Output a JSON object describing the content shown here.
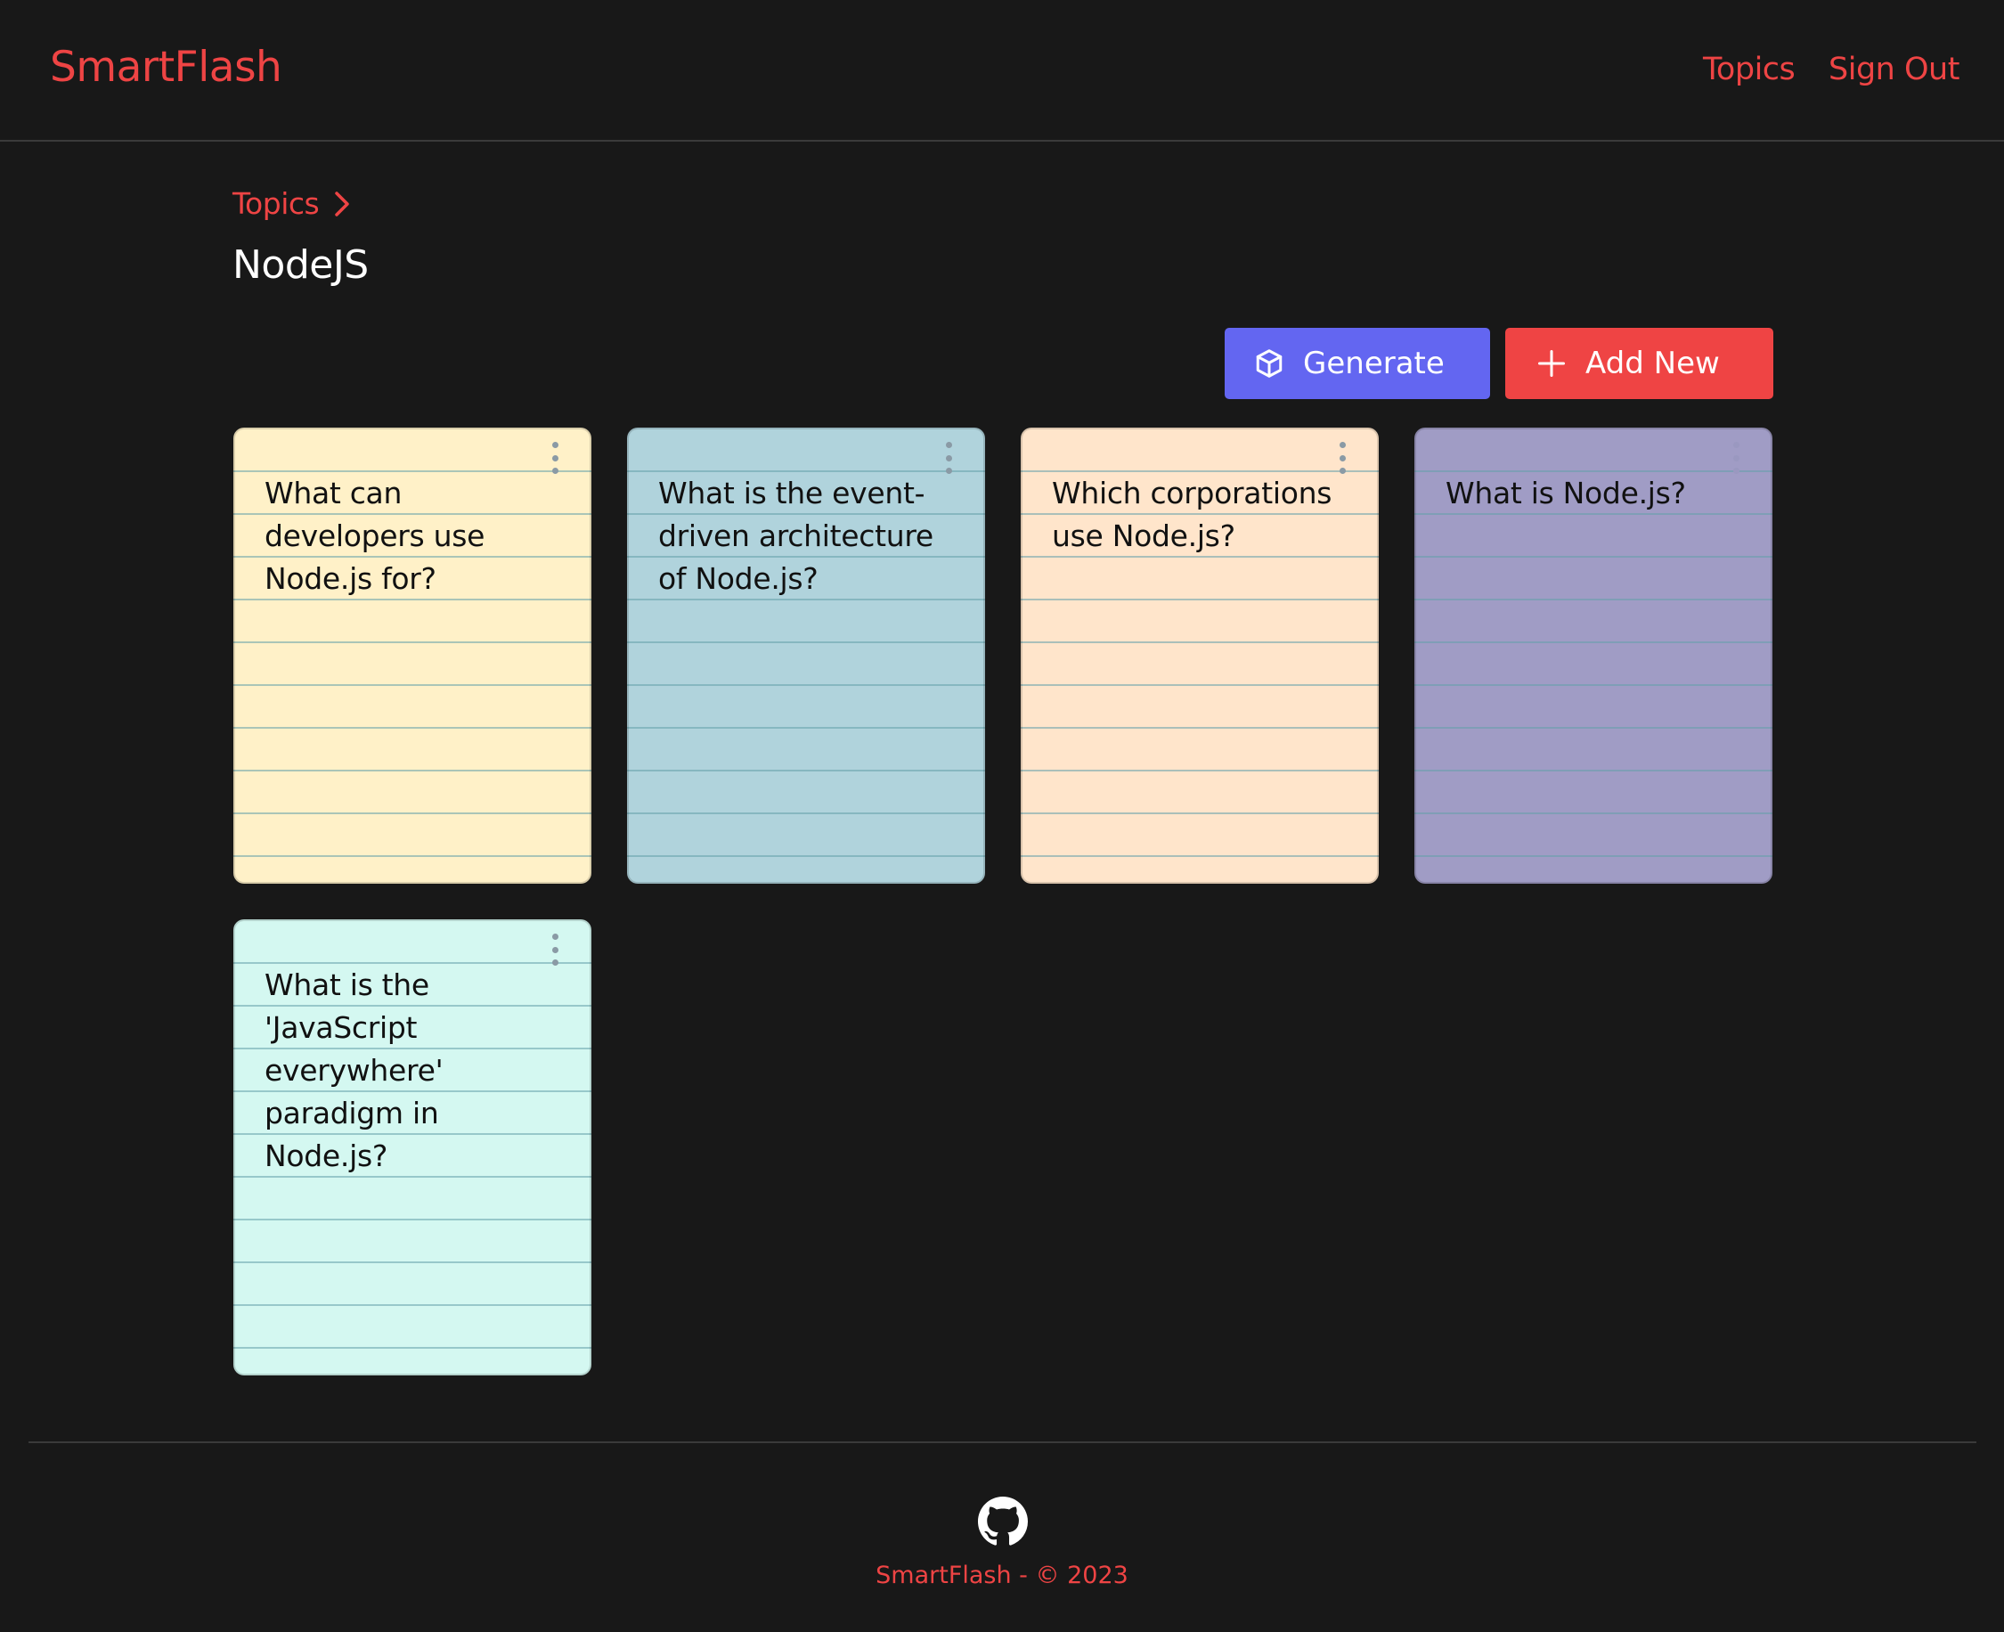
{
  "navbar": {
    "brand": "SmartFlash",
    "links": [
      "Topics",
      "Sign Out"
    ]
  },
  "breadcrumb": {
    "parent": "Topics",
    "separator_icon": "chevron-right-icon"
  },
  "page": {
    "title": "NodeJS"
  },
  "actions": {
    "generate_label": "Generate",
    "generate_icon": "cube-icon",
    "add_label": "Add New",
    "add_icon": "plus-icon"
  },
  "cards": [
    {
      "question": "What can developers use Node.js for?",
      "color": "#fff1c8"
    },
    {
      "question": "What is the event-driven architecture of Node.js?",
      "color": "#b0d3dc"
    },
    {
      "question": "Which corporations use Node.js?",
      "color": "#ffe5cb"
    },
    {
      "question": "What is Node.js?",
      "color": "#a09cc5"
    },
    {
      "question": "What is the 'JavaScript everywhere' paradigm in Node.js?",
      "color": "#d4f8f1"
    }
  ],
  "footer": {
    "icon": "github-icon",
    "text": "SmartFlash - © 2023"
  },
  "colors": {
    "background": "#181818",
    "accent": "#ee4444",
    "generate": "#6366f1",
    "add": "#ef4444"
  }
}
